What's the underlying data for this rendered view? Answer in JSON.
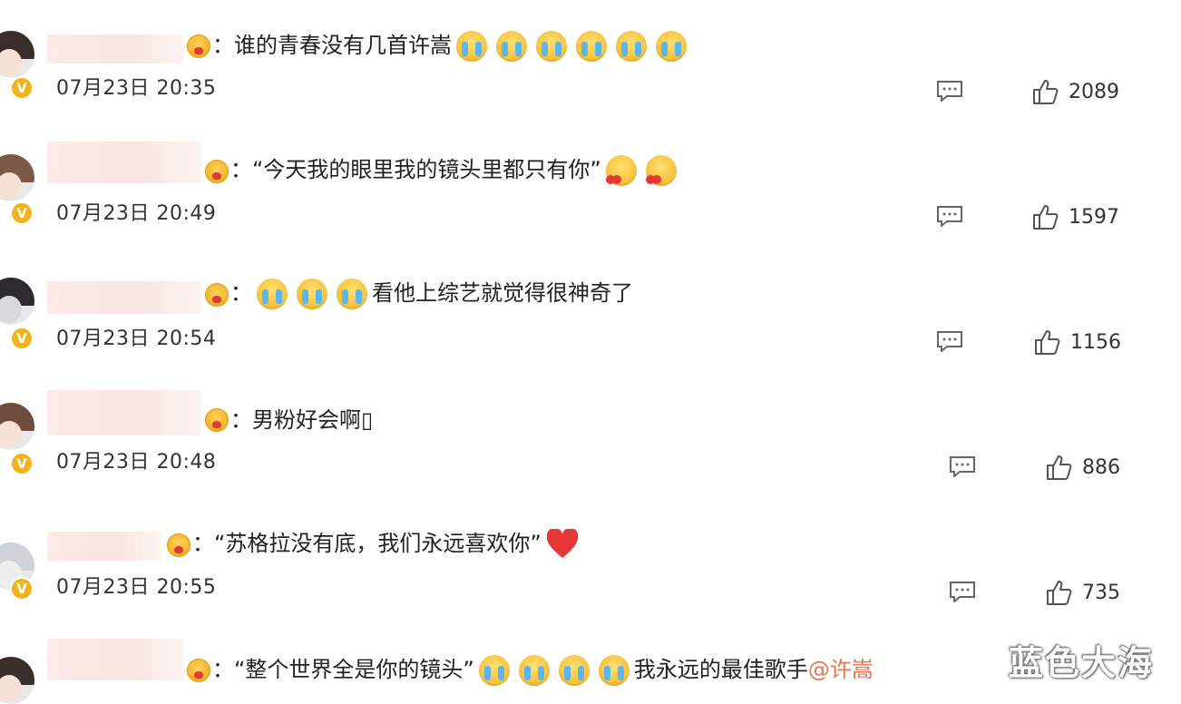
{
  "comments": [
    {
      "text": "：谁的青春没有几首许嵩",
      "emojis": [
        "crying-emoji",
        "crying-emoji",
        "crying-emoji",
        "crying-emoji",
        "crying-emoji",
        "crying-emoji"
      ],
      "time": "07月23日 20:35",
      "likes": "2089"
    },
    {
      "text": "：“今天我的眼里我的镜头里都只有你”",
      "emojis": [
        "love-emoji",
        "love-emoji"
      ],
      "time": "07月23日 20:49",
      "likes": "1597"
    },
    {
      "text_pre": "：",
      "text": "看他上综艺就觉得很神奇了",
      "emojis": [
        "crying-emoji",
        "crying-emoji",
        "crying-emoji"
      ],
      "time": "07月23日 20:54",
      "likes": "1156"
    },
    {
      "text": "：男粉好会啊▯",
      "time": "07月23日 20:48",
      "likes": "886"
    },
    {
      "text": "：“苏格拉没有底，我们永远喜欢你”",
      "emojis": [
        "heart-emoji"
      ],
      "time": "07月23日 20:55",
      "likes": "735"
    },
    {
      "text": "：“整个世界全是你的镜头”",
      "text_after": "我永远的最佳歌手",
      "mention": "@许嵩",
      "emojis": [
        "crying-emoji",
        "crying-emoji",
        "crying-emoji",
        "crying-emoji"
      ]
    }
  ],
  "watermark": "蓝色大海",
  "colors": {
    "verified_badge": "#f3b21b",
    "mention": "#eb7350",
    "heart": "#e53638"
  },
  "icons": {
    "reply": "comment-icon",
    "like": "thumbs-up-icon",
    "verified": "verified-v-icon",
    "mood": "heart-face-icon"
  }
}
